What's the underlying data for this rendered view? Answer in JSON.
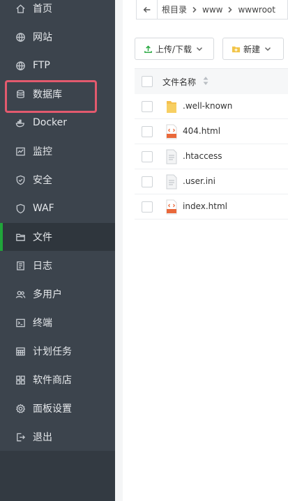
{
  "sidebar": {
    "items": [
      {
        "label": "首页",
        "icon": "home-icon"
      },
      {
        "label": "网站",
        "icon": "globe-icon"
      },
      {
        "label": "FTP",
        "icon": "ftp-globe-icon"
      },
      {
        "label": "数据库",
        "icon": "database-icon"
      },
      {
        "label": "Docker",
        "icon": "docker-icon"
      },
      {
        "label": "监控",
        "icon": "monitor-icon"
      },
      {
        "label": "安全",
        "icon": "shield-icon"
      },
      {
        "label": "WAF",
        "icon": "waf-shield-icon"
      },
      {
        "label": "文件",
        "icon": "folder-icon"
      },
      {
        "label": "日志",
        "icon": "log-icon"
      },
      {
        "label": "多用户",
        "icon": "users-icon"
      },
      {
        "label": "终端",
        "icon": "terminal-icon"
      },
      {
        "label": "计划任务",
        "icon": "calendar-icon"
      },
      {
        "label": "软件商店",
        "icon": "apps-grid-icon"
      },
      {
        "label": "面板设置",
        "icon": "gear-icon"
      },
      {
        "label": "退出",
        "icon": "logout-icon"
      }
    ],
    "active_item": "文件",
    "highlighted_item": "数据库",
    "active_color": "#20a53a",
    "highlight_color": "#e35a6e"
  },
  "breadcrumb": {
    "segments": [
      "根目录",
      "www",
      "wwwroot"
    ]
  },
  "toolbar": {
    "upload_label": "上传/下载",
    "new_label": "新建"
  },
  "table": {
    "header": "文件名称",
    "rows": [
      {
        "name": ".well-known",
        "type": "folder"
      },
      {
        "name": "404.html",
        "type": "html"
      },
      {
        "name": ".htaccess",
        "type": "file"
      },
      {
        "name": ".user.ini",
        "type": "file"
      },
      {
        "name": "index.html",
        "type": "html"
      }
    ]
  }
}
